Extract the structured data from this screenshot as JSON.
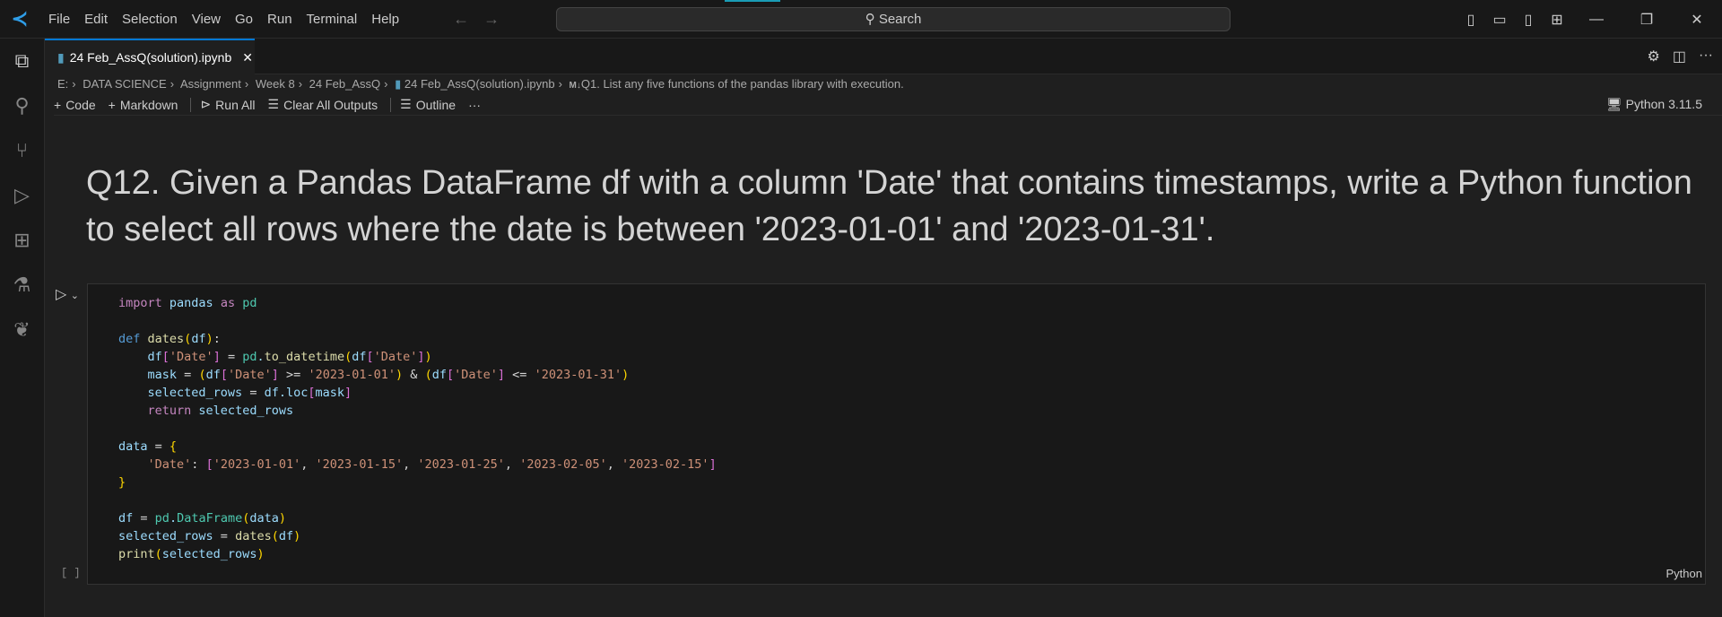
{
  "menu": [
    "File",
    "Edit",
    "Selection",
    "View",
    "Go",
    "Run",
    "Terminal",
    "Help"
  ],
  "search": "Search",
  "tab": {
    "label": "24 Feb_AssQ(solution).ipynb"
  },
  "breadcrumbs": [
    "E:",
    "DATA SCIENCE",
    "Assignment",
    "Week 8",
    "24 Feb_AssQ",
    "24 Feb_AssQ(solution).ipynb",
    "Q1. List any five functions of the pandas library with execution."
  ],
  "toolbar": {
    "code": "Code",
    "markdown": "Markdown",
    "run_all": "Run All",
    "clear": "Clear All Outputs",
    "outline": "Outline",
    "more": "···"
  },
  "kernel": "Python 3.11.5",
  "markdown": "Q12. Given a Pandas DataFrame df with a column 'Date' that contains timestamps, write a Python function to select all rows where the date is between '2023-01-01' and '2023-01-31'.",
  "cell": {
    "exec": "[ ]",
    "language": "Python",
    "code": "import pandas as pd\n\ndef dates(df):\n    df['Date'] = pd.to_datetime(df['Date'])\n    mask = (df['Date'] >= '2023-01-01') & (df['Date'] <= '2023-01-31')\n    selected_rows = df.loc[mask]\n    return selected_rows\n\ndata = {\n    'Date': ['2023-01-01', '2023-01-15', '2023-01-25', '2023-02-05', '2023-02-15']\n}\n\ndf = pd.DataFrame(data)\nselected_rows = dates(df)\nprint(selected_rows)"
  }
}
